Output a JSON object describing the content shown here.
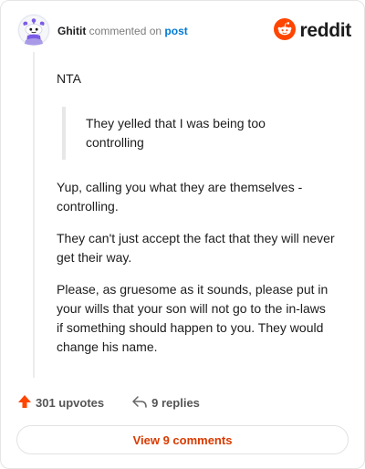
{
  "header": {
    "author": "Ghitit",
    "commented_text": "commented on",
    "post_link": "post",
    "brand": "reddit"
  },
  "comment": {
    "paragraph_1": "NTA",
    "quote": "They yelled that I was being too controlling",
    "paragraph_2": "Yup, calling you what they are themselves - controlling.",
    "paragraph_3": "They can't just accept the fact that they will never get their way.",
    "paragraph_4": "Please, as gruesome as it sounds, please put in your wills that your son will not go to the in-laws if something should happen to you. They would change his name."
  },
  "footer": {
    "upvotes": "301 upvotes",
    "replies": "9 replies"
  },
  "view_button": "View 9 comments",
  "icons": {
    "avatar": "snoo-avatar-icon",
    "brand": "reddit-logo-icon",
    "upvote": "upvote-arrow-icon",
    "reply": "reply-arrow-icon"
  },
  "colors": {
    "accent": "#ff4500",
    "link": "#0079d3",
    "button_text": "#d93a00"
  }
}
